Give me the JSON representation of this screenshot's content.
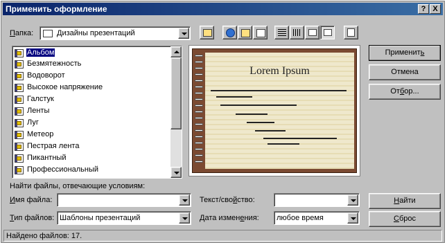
{
  "window": {
    "title": "Применить оформление",
    "help_btn": "?",
    "close_btn": "X"
  },
  "folder": {
    "label": "Папка:",
    "label_accel": "П",
    "label_rest": "апка:",
    "value": "Дизайны презентаций"
  },
  "files": [
    "Альбом",
    "Безмятежность",
    "Водоворот",
    "Высокое напряжение",
    "Галстук",
    "Ленты",
    "Луг",
    "Метеор",
    "Пестрая лента",
    "Пикантный",
    "Профессиональный"
  ],
  "selected_index": 0,
  "preview": {
    "title": "Lorem Ipsum"
  },
  "buttons": {
    "apply_pre": "Применит",
    "apply_accel": "ь",
    "cancel": "Отмена",
    "filter_pre": "От",
    "filter_accel": "б",
    "filter_post": "ор...",
    "find_accel": "Н",
    "find_post": "айти",
    "reset_accel": "С",
    "reset_post": "брос"
  },
  "search": {
    "heading": "Найти файлы, отвечающие условиям:",
    "filename_accel": "И",
    "filename_post": "мя файла:",
    "filename_value": "",
    "filetype_accel": "Т",
    "filetype_post": "ип файлов:",
    "filetype_value": "Шаблоны презентаций",
    "text_pre": "Текст/сво",
    "text_accel": "й",
    "text_post": "ство:",
    "text_value": "",
    "date_pre": "Дата измен",
    "date_accel": "е",
    "date_post": "ния:",
    "date_value": "любое время"
  },
  "status": {
    "text": "Найдено файлов: 17."
  },
  "colors": {
    "titlebar": "#0a246a",
    "selection": "#000080",
    "slide_frame": "#7b4a32"
  }
}
